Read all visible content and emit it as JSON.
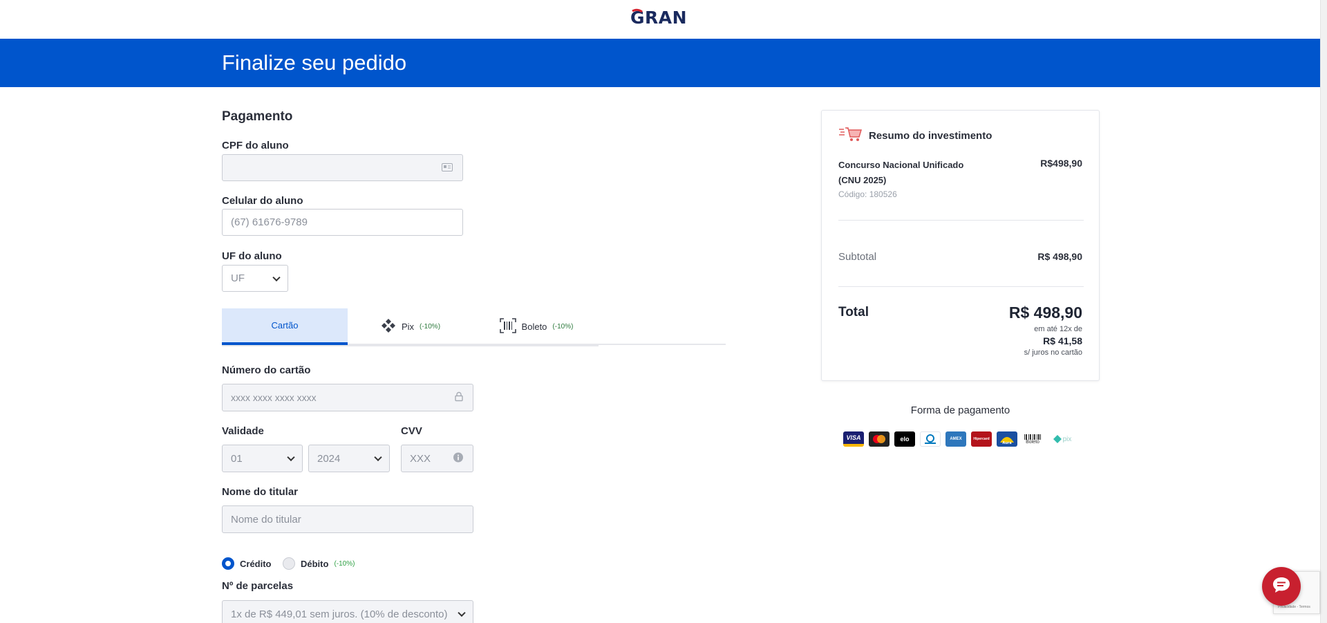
{
  "header": {
    "logo_text": "GRAN",
    "page_title": "Finalize seu pedido"
  },
  "payment": {
    "section_title": "Pagamento",
    "cpf": {
      "label": "CPF do aluno",
      "value": ""
    },
    "phone": {
      "label": "Celular do aluno",
      "placeholder": "(67) 61676-9789"
    },
    "uf": {
      "label": "UF do aluno",
      "selected": "UF"
    }
  },
  "methods": {
    "tabs": [
      {
        "label": "Cartão",
        "discount": "",
        "icon": "credit-card-icon",
        "active": true
      },
      {
        "label": "Pix",
        "discount": "(-10%)",
        "icon": "pix-icon",
        "active": false
      },
      {
        "label": "Boleto",
        "discount": "(-10%)",
        "icon": "barcode-icon",
        "active": false
      }
    ]
  },
  "card_form": {
    "number": {
      "label": "Número do cartão",
      "placeholder": "xxxx xxxx xxxx xxxx"
    },
    "expiry": {
      "label": "Validade",
      "month": "01",
      "year": "2024"
    },
    "cvv": {
      "label": "CVV",
      "placeholder": "XXX"
    },
    "holder": {
      "label": "Nome do titular",
      "placeholder": "Nome do titular"
    },
    "type": {
      "credit": "Crédito",
      "debit": "Débito",
      "debit_discount": "(-10%)",
      "selected": "credit"
    },
    "installments": {
      "label": "Nº de parcelas",
      "selected": "1x de R$ 449,01 sem juros. (10% de desconto)"
    }
  },
  "summary": {
    "title": "Resumo do investimento",
    "product_name": "Concurso Nacional Unificado (CNU 2025)",
    "product_code": "Código: 180526",
    "product_price": "R$498,90",
    "subtotal_label": "Subtotal",
    "subtotal_value": "R$ 498,90",
    "total_label": "Total",
    "total_value": "R$ 498,90",
    "installment_prefix": "em até 12x de",
    "installment_value": "R$ 41,58",
    "installment_suffix": "s/ juros no cartão"
  },
  "payment_methods": {
    "title": "Forma de pagamento",
    "brands": [
      {
        "name": "VISA",
        "color": "#1a1f71"
      },
      {
        "name": "Mastercard",
        "color": "#222222"
      },
      {
        "name": "elo",
        "color": "#000000"
      },
      {
        "name": "Diners Club",
        "color": "#ffffff"
      },
      {
        "name": "AMEX",
        "color": "#2e77bc"
      },
      {
        "name": "Hipercard",
        "color": "#b3131b"
      },
      {
        "name": "Aura",
        "color": "#1a4fa0"
      },
      {
        "name": "Boleto",
        "color": "#ffffff"
      },
      {
        "name": "pix",
        "color": "#ffffff"
      }
    ]
  },
  "colors": {
    "primary": "#0055cc",
    "brand_red": "#d6232f",
    "chat_button": "#c8202f"
  }
}
